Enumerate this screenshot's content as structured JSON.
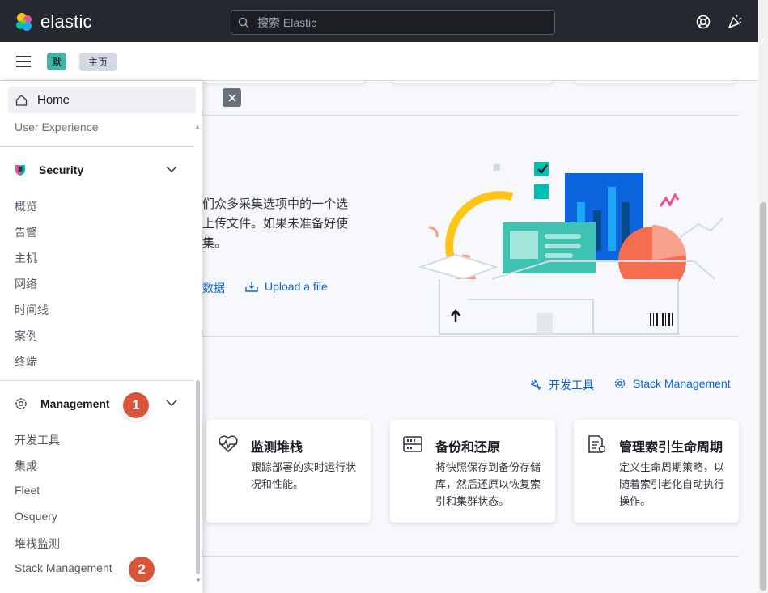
{
  "header": {
    "logo_text": "elastic",
    "search_placeholder": "搜索 Elastic",
    "icons": [
      "help-lifebuoy-icon",
      "newsfeed-cheer-icon"
    ]
  },
  "subbar": {
    "space_badge": "默",
    "breadcrumb": "主页"
  },
  "nav": {
    "home_label": "Home",
    "ux_label": "User Experience",
    "security": {
      "title": "Security",
      "items": [
        "概览",
        "告警",
        "主机",
        "网络",
        "时间线",
        "案例",
        "终端"
      ]
    },
    "management": {
      "title": "Management",
      "items": [
        "开发工具",
        "集成",
        "Fleet",
        "Osquery",
        "堆栈监测",
        "Stack Management"
      ]
    }
  },
  "annotations": [
    "1",
    "2"
  ],
  "main": {
    "intro_lines": [
      "们众多采集选项中的一个选",
      "上传文件。如果未准备好使",
      "集。"
    ],
    "add_data_partial": "数据",
    "upload_label": "Upload a file",
    "devtools_label": "开发工具",
    "stack_mgmt_label": "Stack Management",
    "cards": [
      {
        "title": "监测堆栈",
        "desc": "跟踪部署的实时运行状况和性能。",
        "icon": "monitoring-heartbeat-icon"
      },
      {
        "title": "备份和还原",
        "desc": "将快照保存到备份存储库，然后还原以恢复索引和集群状态。",
        "icon": "storage-backup-icon"
      },
      {
        "title": "管理索引生命周期",
        "desc": "定义生命周期策略，以随着索引老化自动执行操作。",
        "icon": "index-lifecycle-icon"
      }
    ]
  },
  "colors": {
    "header_bg": "#25282f",
    "link": "#0b64dd",
    "space_badge": "#3fb5a5",
    "annotation_badge": "#d8553a"
  }
}
